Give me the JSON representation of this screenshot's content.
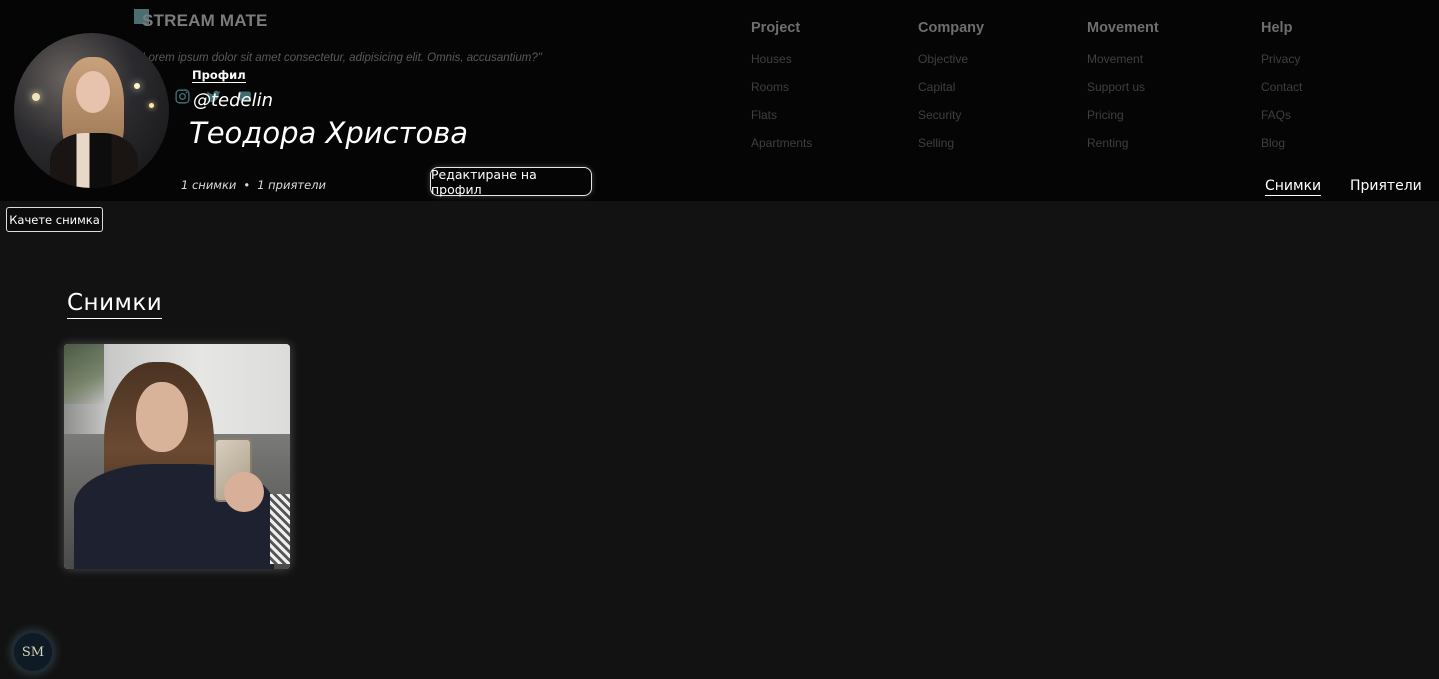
{
  "brand": {
    "name": "STREAM MATE",
    "tagline": "\"Lorem ipsum dolor sit amet consectetur, adipisicing elit. Omnis, accusantium?\""
  },
  "profile": {
    "section_label": "Профил",
    "username": "@tedelin",
    "full_name": "Теодора Христова",
    "photos_count": "1 снимки",
    "friends_count": "1 приятели",
    "edit_button": "Редактиране на профил"
  },
  "link_columns": [
    {
      "title": "Project",
      "links": [
        "Houses",
        "Rooms",
        "Flats",
        "Apartments"
      ]
    },
    {
      "title": "Company",
      "links": [
        "Objective",
        "Capital",
        "Security",
        "Selling"
      ]
    },
    {
      "title": "Movement",
      "links": [
        "Movement",
        "Support us",
        "Pricing",
        "Renting"
      ]
    },
    {
      "title": "Help",
      "links": [
        "Privacy",
        "Contact",
        "FAQs",
        "Blog"
      ]
    }
  ],
  "tabs": {
    "photos": "Снимки",
    "friends": "Приятели"
  },
  "upload_button": "Качете снимка",
  "photos_section": {
    "title": "Снимки"
  },
  "badge": {
    "text": "SM"
  },
  "colors": {
    "background": "#121212",
    "header": "#050505",
    "accent": "#4b6e72"
  },
  "icons": [
    "instagram-icon",
    "twitter-icon",
    "message-icon"
  ]
}
